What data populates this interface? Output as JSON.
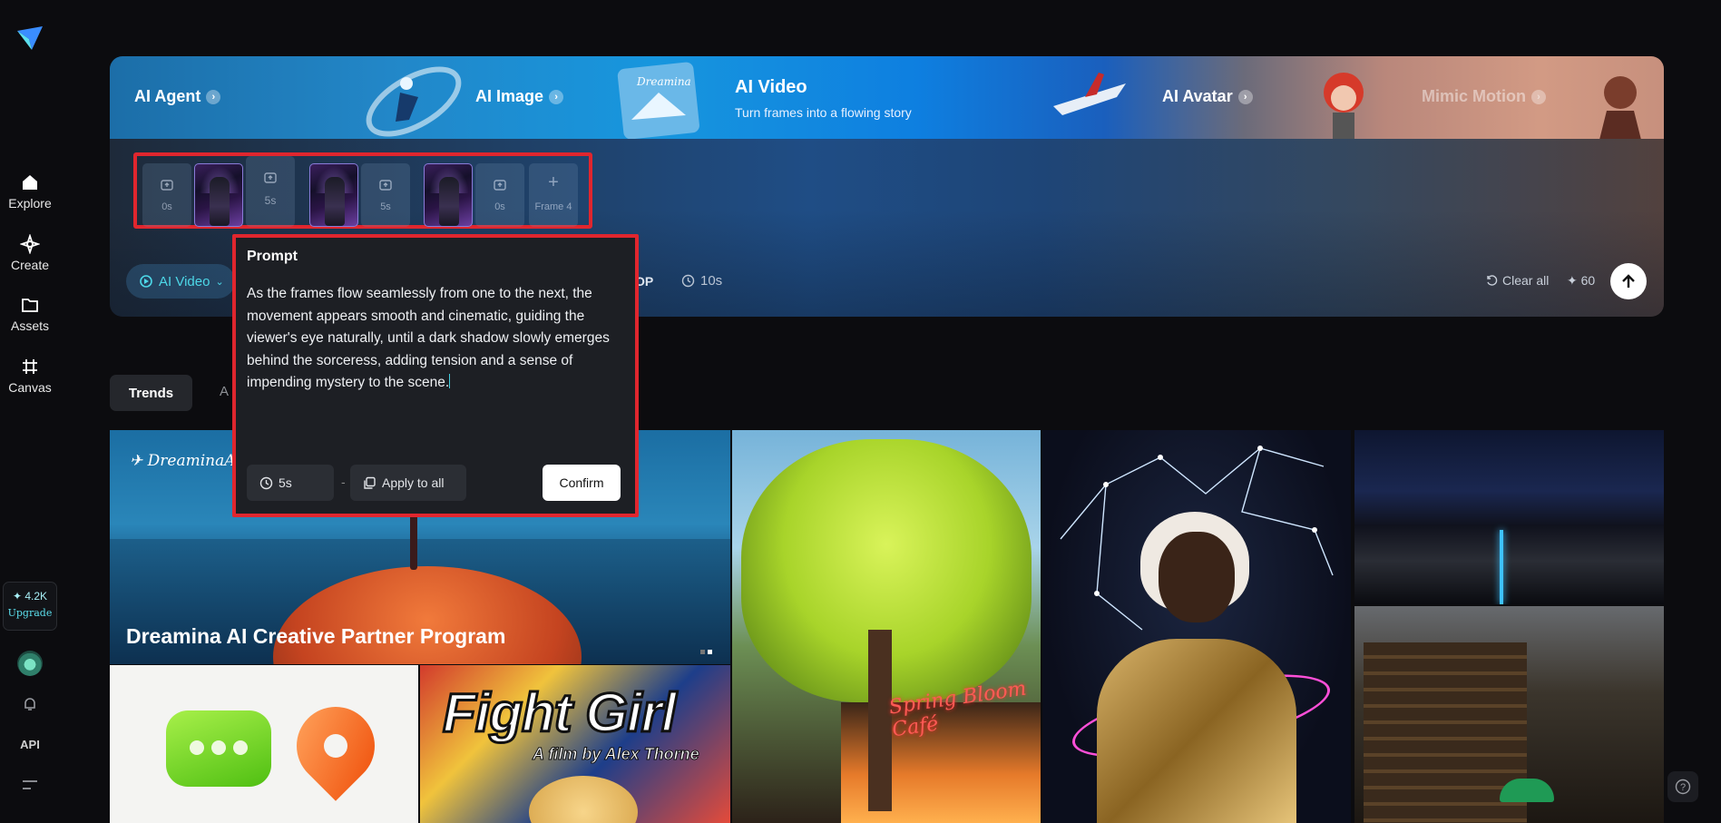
{
  "sidebar": {
    "nav": [
      {
        "label": "Explore",
        "icon": "home-icon"
      },
      {
        "label": "Create",
        "icon": "sparkle-icon"
      },
      {
        "label": "Assets",
        "icon": "folder-icon"
      },
      {
        "label": "Canvas",
        "icon": "grid-icon"
      }
    ],
    "credits": "✦ 4.2K",
    "upgrade": "Upgrade",
    "api": "API"
  },
  "banner": {
    "tabs": [
      "AI Agent",
      "AI Image",
      "AI Avatar",
      "Mimic Motion"
    ],
    "active_title": "AI Video",
    "active_subtitle": "Turn frames into a flowing story",
    "art_caption": "Dreamina"
  },
  "composer": {
    "frames": [
      {
        "type": "empty",
        "duration": "0s"
      },
      {
        "type": "image"
      },
      {
        "type": "empty",
        "duration": "5s"
      },
      {
        "type": "image"
      },
      {
        "type": "empty",
        "duration": "5s"
      },
      {
        "type": "image"
      },
      {
        "type": "empty",
        "duration": "0s"
      },
      {
        "type": "add",
        "label": "Frame 4"
      }
    ],
    "mode": "AI Video",
    "op_text": "OP",
    "total_duration": "10s",
    "clear_all": "Clear all",
    "cost": "✦ 60"
  },
  "prompt_popup": {
    "title": "Prompt",
    "text": "As the frames flow seamlessly from one to the next, the movement appears smooth and cinematic, guiding the viewer's eye naturally, until a dark shadow slowly emerges behind the sorceress, adding tension and a sense of impending mystery to the scene.",
    "duration": "5s",
    "separator": "-",
    "apply_all": "Apply to all",
    "confirm": "Confirm"
  },
  "feed": {
    "tabs": [
      "Trends",
      "A"
    ],
    "hero_brand": "DreaminaAI",
    "hero_title": "Dreamina AI Creative Partner Program",
    "poster_title": "Fight Girl",
    "poster_sub": "A film by Alex Thorne",
    "cafe_sign": "Spring Bloom Café"
  },
  "colors": {
    "accent": "#4dd8e8",
    "highlight": "#e0262e",
    "panel": "#1d1f24"
  }
}
